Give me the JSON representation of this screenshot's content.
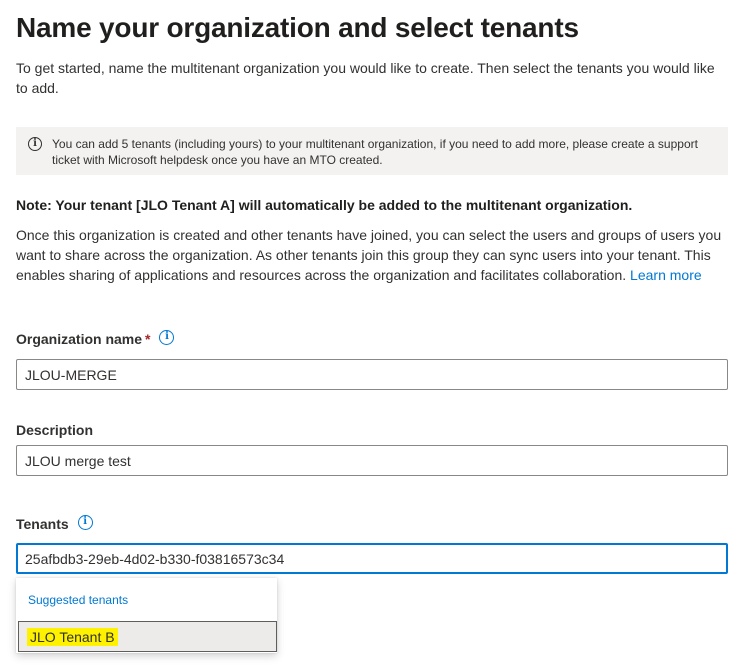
{
  "page": {
    "title": "Name your organization and select tenants",
    "intro": "To get started, name the multitenant organization you would like to create. Then select the tenants you would like to add."
  },
  "infobar": {
    "icon": "info-icon",
    "text": "You can add 5 tenants (including yours) to your multitenant organization, if you need to add more, please create a support ticket with Microsoft helpdesk once you have an MTO created."
  },
  "note": "Note: Your tenant [JLO Tenant A] will automatically be added to the multitenant organization.",
  "description": {
    "text": "Once this organization is created and other tenants have joined, you can select the users and groups of users you want to share across the organization. As other tenants join this group they can sync users into your tenant. This enables sharing of applications and resources across the organization and facilitates collaboration.",
    "link": "Learn more"
  },
  "form": {
    "org_name": {
      "label": "Organization name",
      "required_marker": "*",
      "value": "JLOU-MERGE"
    },
    "description": {
      "label": "Description",
      "value": "JLOU merge test"
    },
    "tenants": {
      "label": "Tenants",
      "value": "25afbdb3-29eb-4d02-b330-f03816573c34"
    }
  },
  "suggestions": {
    "header": "Suggested tenants",
    "items": [
      {
        "label": "JLO Tenant B"
      }
    ]
  },
  "colors": {
    "accent": "#0078d4",
    "required": "#a4262c",
    "highlight": "#fff200",
    "infobar_bg": "#f3f2f1"
  }
}
